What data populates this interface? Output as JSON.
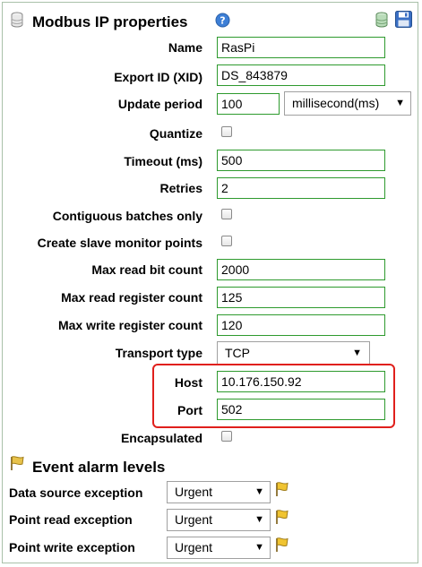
{
  "header": {
    "title": "Modbus IP properties",
    "help_icon": "help-icon",
    "db_icon": "database-icon",
    "save_icon": "save-icon"
  },
  "fields": {
    "name": {
      "label": "Name",
      "value": "RasPi"
    },
    "xid": {
      "label": "Export ID (XID)",
      "value": "DS_843879"
    },
    "update_period": {
      "label": "Update period",
      "value": "100",
      "unit": "millisecond(ms)"
    },
    "quantize": {
      "label": "Quantize"
    },
    "timeout": {
      "label": "Timeout (ms)",
      "value": "500"
    },
    "retries": {
      "label": "Retries",
      "value": "2"
    },
    "contiguous": {
      "label": "Contiguous batches only"
    },
    "slave_monitor": {
      "label": "Create slave monitor points"
    },
    "max_read_bit": {
      "label": "Max read bit count",
      "value": "2000"
    },
    "max_read_reg": {
      "label": "Max read register count",
      "value": "125"
    },
    "max_write_reg": {
      "label": "Max write register count",
      "value": "120"
    },
    "transport": {
      "label": "Transport type",
      "value": "TCP"
    },
    "host": {
      "label": "Host",
      "value": "10.176.150.92"
    },
    "port": {
      "label": "Port",
      "value": "502"
    },
    "encapsulated": {
      "label": "Encapsulated"
    }
  },
  "alarms": {
    "title": "Event alarm levels",
    "items": [
      {
        "label": "Data source exception",
        "value": "Urgent"
      },
      {
        "label": "Point read exception",
        "value": "Urgent"
      },
      {
        "label": "Point write exception",
        "value": "Urgent"
      }
    ]
  },
  "colors": {
    "field_border": "#2e9a2e",
    "highlight": "#e0201c",
    "panel_border": "#a9c0a9"
  }
}
